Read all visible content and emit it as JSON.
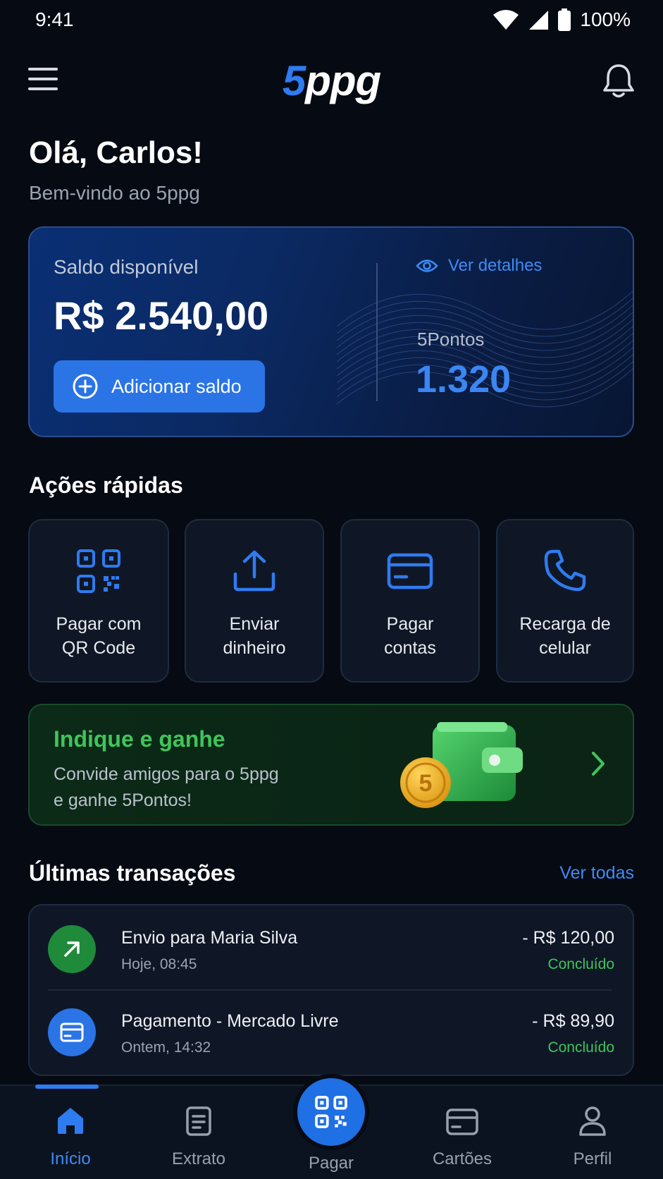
{
  "status_bar": {
    "time": "9:41",
    "battery": "100%"
  },
  "header": {
    "logo_number": "5",
    "logo_text": "ppg"
  },
  "greeting": {
    "title": "Olá, Carlos!",
    "subtitle": "Bem-vindo ao 5ppg"
  },
  "balance": {
    "label": "Saldo disponível",
    "value": "R$ 2.540,00",
    "add_button": "Adicionar saldo",
    "details_link": "Ver detalhes",
    "points_label": "5Pontos",
    "points_value": "1.320"
  },
  "quick_actions": {
    "title": "Ações rápidas",
    "items": [
      {
        "line1": "Pagar com",
        "line2": "QR Code",
        "icon": "qr-code-icon"
      },
      {
        "line1": "Enviar",
        "line2": "dinheiro",
        "icon": "upload-icon"
      },
      {
        "line1": "Pagar",
        "line2": "contas",
        "icon": "credit-card-icon"
      },
      {
        "line1": "Recarga de",
        "line2": "celular",
        "icon": "phone-icon"
      }
    ]
  },
  "promo": {
    "title": "Indique e ganhe",
    "line1": "Convide amigos para o 5ppg",
    "line2": "e ganhe 5Pontos!",
    "coin_text": "5"
  },
  "transactions": {
    "title": "Últimas transações",
    "see_all": "Ver todas",
    "items": [
      {
        "name": "Envio para Maria Silva",
        "time": "Hoje, 08:45",
        "amount": "- R$ 120,00",
        "status": "Concluído",
        "icon": "arrow-up-right-icon",
        "color": "#1f8a3a"
      },
      {
        "name": "Pagamento - Mercado Livre",
        "time": "Ontem, 14:32",
        "amount": "- R$ 89,90",
        "status": "Concluído",
        "icon": "credit-card-icon",
        "color": "#2a74e6"
      }
    ]
  },
  "bottom_nav": {
    "items": [
      {
        "label": "Início",
        "icon": "home-icon",
        "active": true
      },
      {
        "label": "Extrato",
        "icon": "document-icon",
        "active": false
      },
      {
        "label": "Pagar",
        "icon": "qr-code-icon",
        "active": false
      },
      {
        "label": "Cartões",
        "icon": "credit-card-icon",
        "active": false
      },
      {
        "label": "Perfil",
        "icon": "user-icon",
        "active": false
      }
    ]
  },
  "colors": {
    "accent": "#2f7bf0",
    "success": "#3fc55a",
    "background": "#060a12"
  }
}
